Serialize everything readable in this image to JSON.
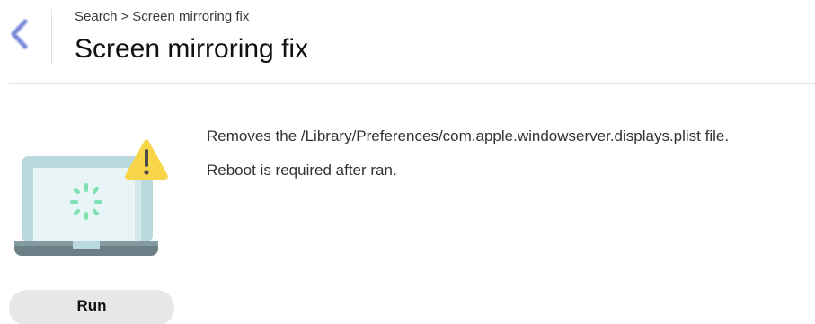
{
  "header": {
    "back_icon": "chevron-left-icon",
    "breadcrumb": {
      "parent": "Search",
      "separator": ">",
      "current": "Screen mirroring fix"
    },
    "title": "Screen mirroring fix"
  },
  "content": {
    "illustration_icon": "laptop-warning-icon",
    "description_lines": [
      "Removes the /Library/Preferences/com.apple.windowserver.displays.plist file.",
      "Reboot is required after ran."
    ]
  },
  "actions": {
    "run_label": "Run"
  },
  "colors": {
    "back_chevron": "#7e8bd9",
    "laptop_body": "#b9d9de",
    "laptop_screen": "#e8f4f6",
    "laptop_base": "#6b7f86",
    "spinner": "#7fe0b2",
    "warning": "#f7d64a",
    "run_button_bg": "#e7e7ea"
  }
}
